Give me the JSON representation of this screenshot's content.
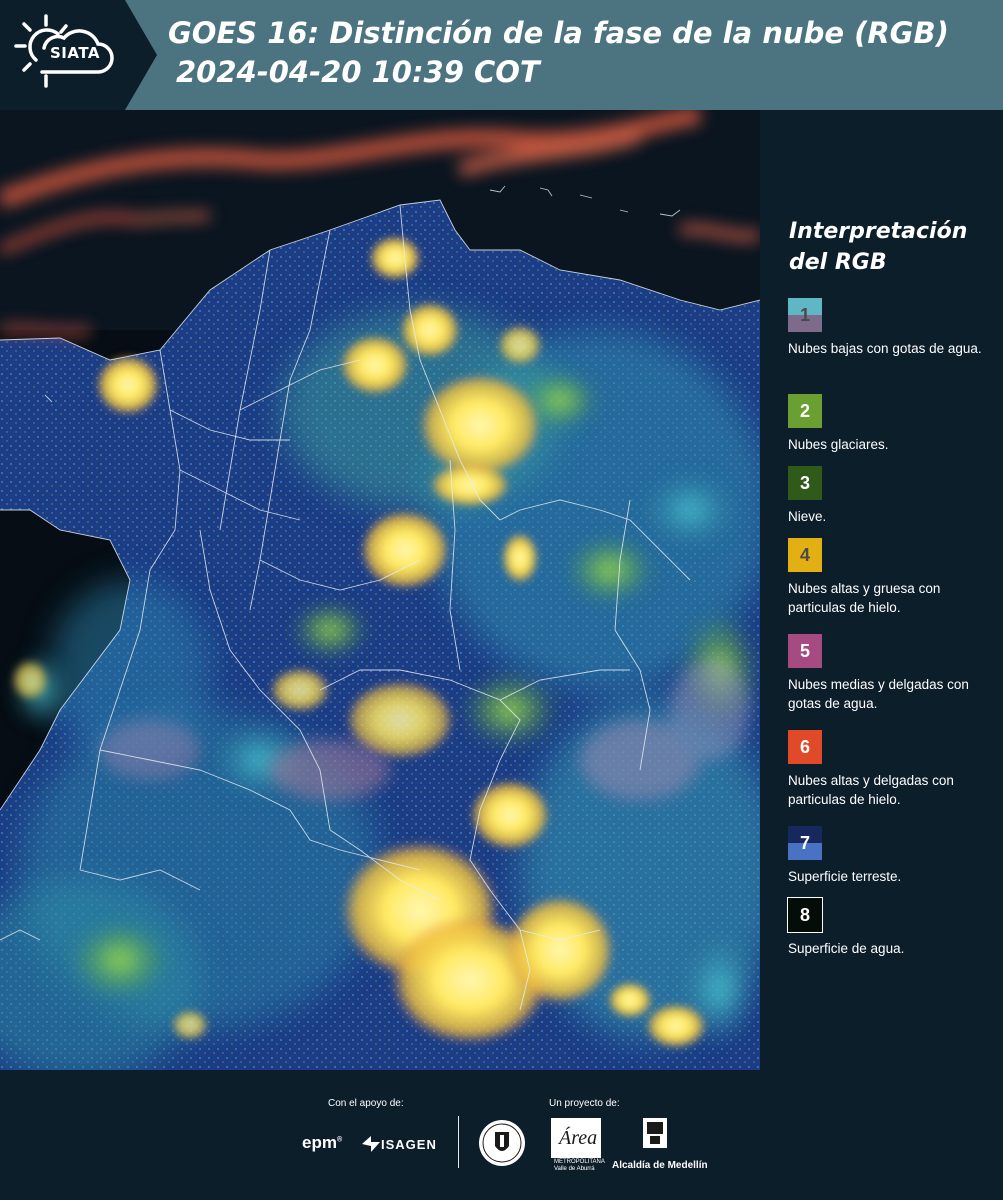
{
  "header": {
    "logo_text": "SIATA",
    "title_line1": "GOES 16: Distinción de la fase de la nube (RGB)",
    "title_line2": "2024-04-20 10:39 COT"
  },
  "map": {
    "description_icon": "satellite-rgb-map"
  },
  "legend": {
    "title": "Interpretación del RGB",
    "items": [
      {
        "number": "1",
        "label": "Nubes bajas con gotas de agua.",
        "color_top": "#5fb6c4",
        "color_bottom": "#7e6b8c",
        "number_color": "#4a4a4a"
      },
      {
        "number": "2",
        "label": "Nubes glaciares.",
        "color_top": "#6aa032",
        "color_bottom": "#6aa032",
        "number_color": "#ffffff"
      },
      {
        "number": "3",
        "label": "Nieve.",
        "color_top": "#2f5a1a",
        "color_bottom": "#2f5a1a",
        "number_color": "#ffffff"
      },
      {
        "number": "4",
        "label": "Nubes altas y gruesa con particulas de hielo.",
        "color_top": "#e2b012",
        "color_bottom": "#e2b012",
        "number_color": "#4a4a4a"
      },
      {
        "number": "5",
        "label": "Nubes medias y delgadas con gotas de agua.",
        "color_top": "#a64a82",
        "color_bottom": "#a64a82",
        "number_color": "#ffffff"
      },
      {
        "number": "6",
        "label": "Nubes altas y delgadas con particulas de hielo.",
        "color_top": "#e04a28",
        "color_bottom": "#e04a28",
        "number_color": "#ffffff"
      },
      {
        "number": "7",
        "label": "Superficie terreste.",
        "color_top": "#17285c",
        "color_bottom": "#4a72c4",
        "number_color": "#ffffff"
      },
      {
        "number": "8",
        "label": "Superficie de agua.",
        "color_top": "#050d08",
        "color_bottom": "#050d08",
        "number_color": "#ffffff"
      }
    ]
  },
  "footer": {
    "support_label": "Con el apoyo de:",
    "project_label": "Un proyecto de:",
    "epm": "epm",
    "epm_mark": "®",
    "isagen": "ISAGEN",
    "area_name": "Área",
    "area_sub": "METROPOLITANA\nValle de Aburrá",
    "alcaldia": "Alcaldía de Medellín"
  },
  "colors": {
    "header_bg": "#4b7380",
    "panel_bg": "#0d1e2b",
    "text": "#ffffff"
  }
}
